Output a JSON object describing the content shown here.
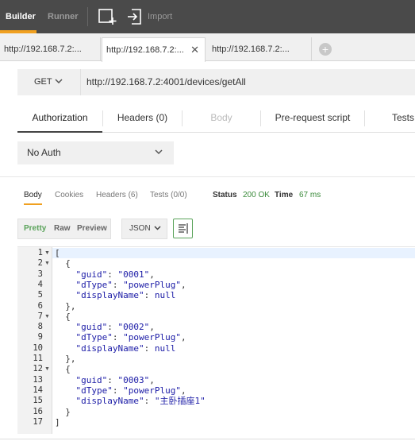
{
  "topbar": {
    "builder": "Builder",
    "runner": "Runner",
    "import": "Import",
    "builder_accent": "#f0a020"
  },
  "tabs": [
    {
      "label": "http://192.168.7.2:..."
    },
    {
      "label": "http://192.168.7.2:...",
      "active": true,
      "close": "✕"
    },
    {
      "label": "http://192.168.7.2:..."
    }
  ],
  "add_tab": "+",
  "request": {
    "method": "GET",
    "url": "http://192.168.7.2:4001/devices/getAll"
  },
  "request_tabs": [
    "Authorization",
    "Headers (0)",
    "Body",
    "Pre-request script",
    "Tests"
  ],
  "auth": {
    "selected": "No Auth"
  },
  "response": {
    "tabs": [
      "Body",
      "Cookies",
      "Headers (6)",
      "Tests (0/0)"
    ],
    "status_label": "Status",
    "status_value": "200 OK",
    "time_label": "Time",
    "time_value": "67 ms",
    "status_color": "#3a8a3a"
  },
  "view": {
    "modes": [
      "Pretty",
      "Raw",
      "Preview"
    ],
    "format": "JSON"
  },
  "code": {
    "line_numbers": [
      "1",
      "2",
      "3",
      "4",
      "5",
      "6",
      "7",
      "8",
      "9",
      "10",
      "11",
      "12",
      "13",
      "14",
      "15",
      "16",
      "17"
    ],
    "lines": [
      "[",
      "  {",
      "    \"guid\": \"0001\",",
      "    \"dType\": \"powerPlug\",",
      "    \"displayName\": null",
      "  },",
      "  {",
      "    \"guid\": \"0002\",",
      "    \"dType\": \"powerPlug\",",
      "    \"displayName\": null",
      "  },",
      "  {",
      "    \"guid\": \"0003\",",
      "    \"dType\": \"powerPlug\",",
      "    \"displayName\": \"主卧插座1\"",
      "  }",
      "]"
    ],
    "fold_lines": [
      1,
      2,
      7,
      12
    ]
  }
}
